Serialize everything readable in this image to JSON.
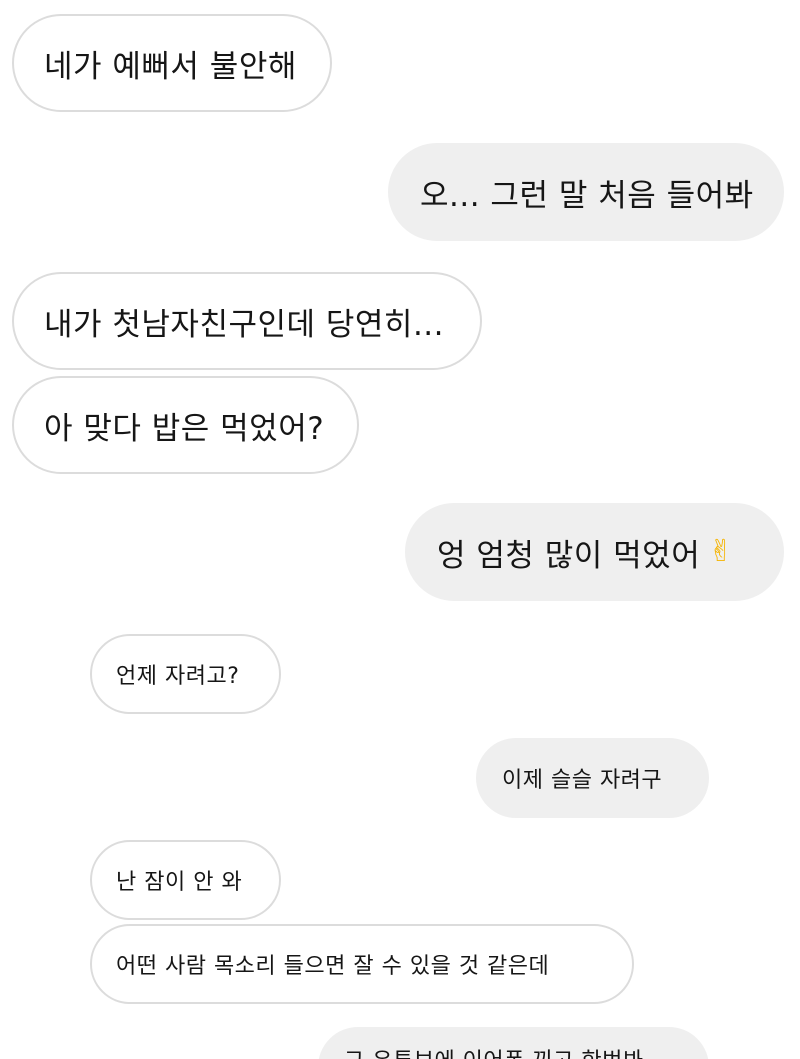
{
  "messages": [
    {
      "side": "received",
      "text": "네가 예뻐서 불안해"
    },
    {
      "side": "sent",
      "text": "오... 그런 말 처음 들어봐"
    },
    {
      "side": "received",
      "text": "내가 첫남자친구인데 당연히..."
    },
    {
      "side": "received",
      "text": "아 맞다 밥은 먹었어?"
    },
    {
      "side": "sent",
      "text": "엉 엄청 많이 먹었어",
      "emoji": "✌"
    },
    {
      "side": "received",
      "text": "언제 자려고?"
    },
    {
      "side": "sent",
      "text": "이제 슬슬 자려구"
    },
    {
      "side": "received",
      "text": "난 잠이 안 와"
    },
    {
      "side": "received",
      "text": "어떤 사람 목소리 들으면 잘 수 있을 것 같은데"
    },
    {
      "side": "sent",
      "text": "그 유튜브에 이어폰 끼고 한번봐"
    }
  ],
  "icons": {
    "victory_hand_emoji": "victory-hand"
  },
  "colors": {
    "received_bubble_bg": "#ffffff",
    "received_bubble_border": "#dcdcdc",
    "sent_bubble_bg": "#efefef",
    "text": "#161616"
  }
}
